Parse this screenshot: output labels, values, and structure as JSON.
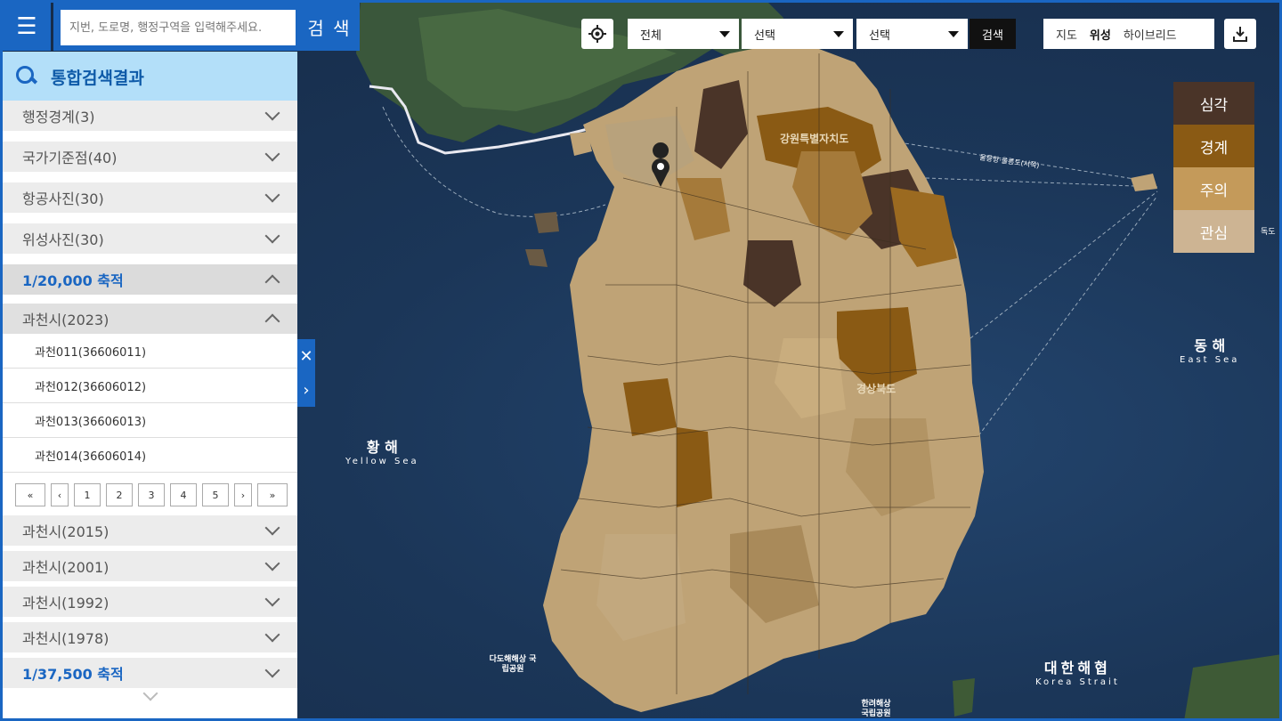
{
  "search": {
    "placeholder": "지번, 도로명, 행정구역을 입력해주세요.",
    "button": "검 색"
  },
  "panel": {
    "title": "통합검색결과",
    "categories": [
      {
        "label": "행정경계(3)"
      },
      {
        "label": "국가기준점(40)"
      },
      {
        "label": "항공사진(30)"
      },
      {
        "label": "위성사진(30)"
      }
    ],
    "scale_group": "1/20,000 축적",
    "year_group": "과천시(2023)",
    "items": [
      "과천011(36606011)",
      "과천012(36606012)",
      "과천013(36606013)",
      "과천014(36606014)"
    ],
    "pager": {
      "first": "«",
      "prev": "‹",
      "pages": [
        "1",
        "2",
        "3",
        "4",
        "5"
      ],
      "next": "›",
      "last": "»"
    },
    "more_years": [
      "과천시(2015)",
      "과천시(2001)",
      "과천시(1992)",
      "과천시(1978)"
    ],
    "scale_group2": "1/37,500 축적",
    "toggle_close": "✕",
    "toggle_expand": "›"
  },
  "toolbar": {
    "select1": "전체",
    "select2": "선택",
    "select3": "선택",
    "search": "검색",
    "maptype": [
      "지도",
      "위성",
      "하이브리드"
    ],
    "maptype_active": "위성"
  },
  "legend": [
    {
      "label": "심각",
      "color": "#4a3428"
    },
    {
      "label": "경계",
      "color": "#8a5a14"
    },
    {
      "label": "주의",
      "color": "#c49a5a"
    },
    {
      "label": "관심",
      "color": "#cdb493"
    }
  ],
  "map_labels": {
    "yellow_sea": "황 해",
    "yellow_sea_en": "Yellow Sea",
    "east_sea": "동 해",
    "east_sea_en": "East Sea",
    "korea_strait": "대한해협",
    "korea_strait_en": "Korea Strait",
    "gangwon": "강원특별자치도",
    "gyeongbuk": "경상북도",
    "dokdo": "독도",
    "ulleung_route": "울릉항·울릉도(서쪽)",
    "park_south": "다도해해상 국립공원",
    "park_hallyeo": "한려해상 국립공원"
  }
}
